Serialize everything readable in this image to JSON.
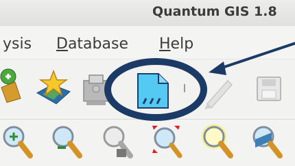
{
  "window": {
    "title": "Quantum GIS 1.8"
  },
  "menu": {
    "items": [
      {
        "label": "ysis",
        "underline": ""
      },
      {
        "label": "Database",
        "underline": "D"
      },
      {
        "label": "Help",
        "underline": "H"
      }
    ]
  },
  "toolbar_row1": {
    "icons": [
      "new-vector-layer-icon",
      "star-map-icon",
      "print-composer-icon",
      "new-spatialite-layer-icon",
      "pencil-edit-icon",
      "save-icon"
    ]
  },
  "toolbar_row2": {
    "icons": [
      "zoom-in-icon",
      "zoom-out-icon",
      "zoom-native-icon",
      "zoom-full-icon",
      "zoom-selection-icon",
      "zoom-layer-icon"
    ]
  },
  "annotation": {
    "highlight_color": "#1c3a66"
  }
}
